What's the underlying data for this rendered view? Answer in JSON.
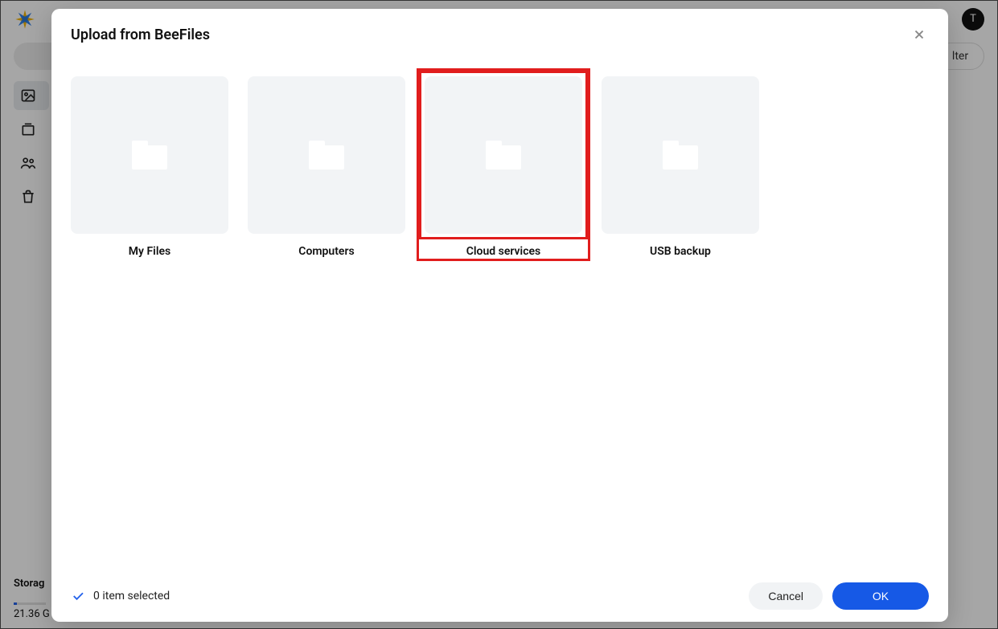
{
  "background": {
    "avatar_initial": "T",
    "filter_label": "lter",
    "storage_label": "Storag",
    "storage_used": "21.36 G"
  },
  "modal": {
    "title": "Upload from BeeFiles",
    "folders": [
      {
        "label": "My Files",
        "highlight": false
      },
      {
        "label": "Computers",
        "highlight": false
      },
      {
        "label": "Cloud services",
        "highlight": true
      },
      {
        "label": "USB backup",
        "highlight": false
      }
    ],
    "selected_text": "0 item selected",
    "cancel_label": "Cancel",
    "ok_label": "OK"
  }
}
